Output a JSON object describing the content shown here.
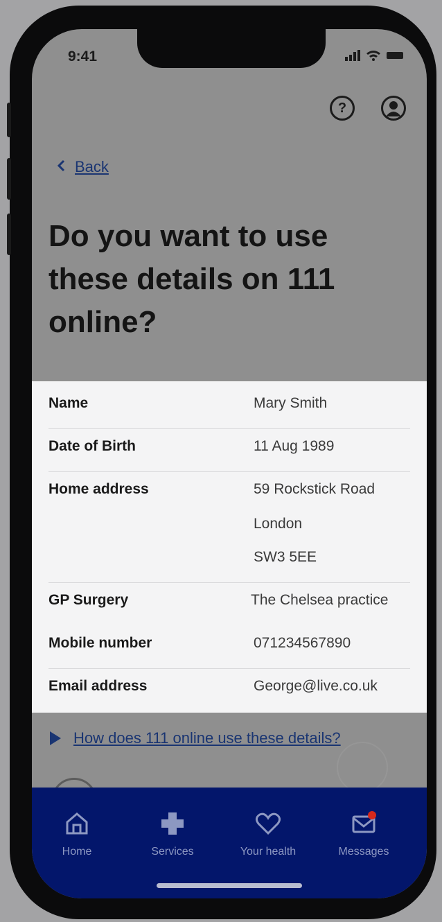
{
  "status": {
    "time": "9:41"
  },
  "nav": {
    "back_label": "Back"
  },
  "page": {
    "title": "Do you want to use these details on 111 online?"
  },
  "details": [
    {
      "label": "Name",
      "value": [
        "Mary Smith"
      ]
    },
    {
      "label": "Date of Birth",
      "value": [
        "11 Aug 1989"
      ]
    },
    {
      "label": "Home address",
      "value": [
        "59 Rockstick Road",
        "London",
        "SW3 5EE"
      ]
    },
    {
      "label": "GP Surgery",
      "value": [
        "The Chelsea practice"
      ]
    },
    {
      "label": "Mobile number",
      "value": [
        "071234567890"
      ]
    },
    {
      "label": "Email address",
      "value": [
        "George@live.co.uk"
      ]
    }
  ],
  "disclosure": {
    "label": "How does 111 online use these details?"
  },
  "tabbar": {
    "items": [
      {
        "label": "Home",
        "icon": "home-icon"
      },
      {
        "label": "Services",
        "icon": "cross-icon"
      },
      {
        "label": "Your health",
        "icon": "heart-icon"
      },
      {
        "label": "Messages",
        "icon": "envelope-icon"
      }
    ]
  },
  "colors": {
    "nhs_blue": "#03166b",
    "link": "#1a3572",
    "badge": "#d5281b"
  }
}
